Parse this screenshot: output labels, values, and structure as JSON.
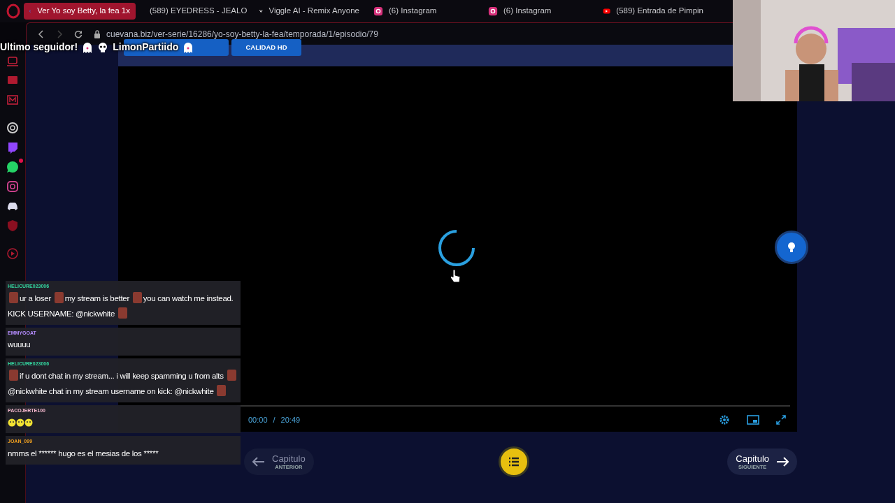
{
  "browser": {
    "tabs": [
      {
        "title": "Ver Yo soy Betty, la fea 1x",
        "kind": "cuevana",
        "selected": true
      },
      {
        "title": "(589) EYEDRESS - JEALO",
        "kind": "youtube",
        "selected": false
      },
      {
        "title": "Viggle AI - Remix Anyone",
        "kind": "viggle",
        "selected": false
      },
      {
        "title": "(6) Instagram",
        "kind": "instagram",
        "selected": false
      },
      {
        "title": "(6) Instagram",
        "kind": "instagram",
        "selected": false
      },
      {
        "title": "(589) Entrada de Pimpin",
        "kind": "youtube",
        "selected": false
      }
    ],
    "address": "cuevana.biz/ver-serie/16286/yo-soy-betty-la-fea/temporada/1/episodio/79",
    "sidebar": [
      {
        "kind": "bot",
        "badge": false
      },
      {
        "kind": "monitor",
        "badge": false
      },
      {
        "kind": "mail",
        "badge": false
      },
      {
        "kind": "flower",
        "badge": false
      },
      {
        "kind": "twitch",
        "badge": false
      },
      {
        "kind": "whatsapp",
        "badge": true
      },
      {
        "kind": "instagram",
        "badge": false
      },
      {
        "kind": "discord",
        "badge": false
      },
      {
        "kind": "shield",
        "badge": false
      },
      {
        "kind": "play",
        "badge": false
      }
    ]
  },
  "player": {
    "quality_buttons": [
      {
        "label": "CALIDAD HD"
      }
    ],
    "time_current": "00:00",
    "time_separator": "/",
    "time_total": "20:49",
    "previous": {
      "label": "Capitulo",
      "sublabel": "ANTERIOR"
    },
    "next": {
      "label": "Capitulo",
      "sublabel": "SIGUIENTE"
    }
  },
  "follower_banner": {
    "text": "Ultimo seguidor!",
    "name": "LimonPartiido"
  },
  "chat": [
    {
      "user": "HELICURE023006",
      "color": "#34d6a0",
      "parts": [
        {
          "kind": "emote"
        },
        {
          "kind": "text",
          "text": "ur a loser"
        },
        {
          "kind": "emote"
        },
        {
          "kind": "text",
          "text": "my stream is better"
        },
        {
          "kind": "emote"
        },
        {
          "kind": "text",
          "text": "you can watch me instead."
        },
        {
          "kind": "text",
          "text": "KICK USERNAME: @nickwhite"
        },
        {
          "kind": "emote"
        }
      ]
    },
    {
      "user": "EMMYGOAT",
      "color": "#b58cff",
      "parts": [
        {
          "kind": "text",
          "text": "wuuuu"
        }
      ]
    },
    {
      "user": "HELICURE023006",
      "color": "#34d6a0",
      "parts": [
        {
          "kind": "emote"
        },
        {
          "kind": "text",
          "text": "if u dont chat in my stream... i will keep spamming u from alts"
        },
        {
          "kind": "emote"
        },
        {
          "kind": "text",
          "text": "@nickwhite chat in my stream username on kick: @nickwhite"
        },
        {
          "kind": "emote"
        }
      ]
    },
    {
      "user": "PACOJERTE100",
      "color": "#f2b6cc",
      "parts": [
        {
          "kind": "smiley"
        },
        {
          "kind": "smiley"
        },
        {
          "kind": "smiley"
        }
      ]
    },
    {
      "user": "JOAN_099",
      "color": "#f0a020",
      "parts": [
        {
          "kind": "text",
          "text": "nmms el ****** hugo es el mesias de los *****"
        }
      ]
    }
  ]
}
